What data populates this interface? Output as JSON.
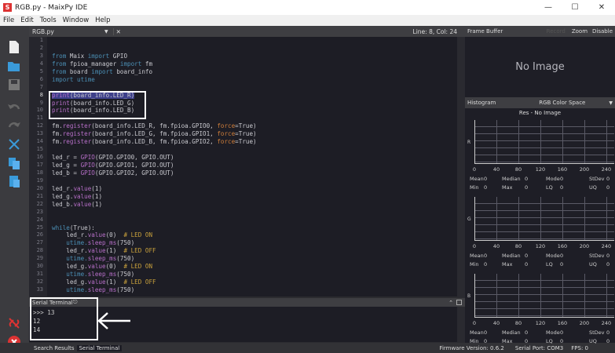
{
  "window": {
    "title": "RGB.py - MaixPy IDE",
    "app_icon": "maixpy-logo"
  },
  "menu": [
    "File",
    "Edit",
    "Tools",
    "Window",
    "Help"
  ],
  "editor": {
    "tab": "RGB.py",
    "cursor": "Line: 8, Col: 24",
    "lines": [
      [],
      [],
      [
        [
          "from ",
          "kw"
        ],
        [
          "Maix ",
          "tx"
        ],
        [
          "import ",
          "kw"
        ],
        [
          "GPIO",
          "tx"
        ]
      ],
      [
        [
          "from ",
          "kw"
        ],
        [
          "fpioa_manager ",
          "tx"
        ],
        [
          "import ",
          "kw"
        ],
        [
          "fm",
          "tx"
        ]
      ],
      [
        [
          "from ",
          "kw"
        ],
        [
          "board ",
          "tx"
        ],
        [
          "import ",
          "kw"
        ],
        [
          "board_info",
          "tx"
        ]
      ],
      [
        [
          "import ",
          "kw"
        ],
        [
          "utime",
          "kw"
        ]
      ],
      [],
      [
        [
          "print",
          "fn sel"
        ],
        [
          "(board_info.LED_R)",
          "tx sel"
        ]
      ],
      [
        [
          "print",
          "fn"
        ],
        [
          "(board_info.LED_G)",
          "tx"
        ]
      ],
      [
        [
          "print",
          "fn"
        ],
        [
          "(board_info.LED_B)",
          "tx"
        ]
      ],
      [],
      [
        [
          "fm.",
          "tx"
        ],
        [
          "register",
          "fn"
        ],
        [
          "(board_info.LED_R, fm.fpioa.GPIO0, ",
          "tx"
        ],
        [
          "force",
          "kwa"
        ],
        [
          "=True)",
          "tx"
        ]
      ],
      [
        [
          "fm.",
          "tx"
        ],
        [
          "register",
          "fn"
        ],
        [
          "(board_info.LED_G, fm.fpioa.GPIO1, ",
          "tx"
        ],
        [
          "force",
          "kwa"
        ],
        [
          "=True)",
          "tx"
        ]
      ],
      [
        [
          "fm.",
          "tx"
        ],
        [
          "register",
          "fn"
        ],
        [
          "(board_info.LED_B, fm.fpioa.GPIO2, ",
          "tx"
        ],
        [
          "force",
          "kwa"
        ],
        [
          "=True)",
          "tx"
        ]
      ],
      [],
      [
        [
          "led_r = ",
          "tx"
        ],
        [
          "GPIO",
          "fn"
        ],
        [
          "(GPIO.GPIO0, GPIO.OUT)",
          "tx"
        ]
      ],
      [
        [
          "led_g = ",
          "tx"
        ],
        [
          "GPIO",
          "fn"
        ],
        [
          "(GPIO.GPIO1, GPIO.OUT)",
          "tx"
        ]
      ],
      [
        [
          "led_b = ",
          "tx"
        ],
        [
          "GPIO",
          "fn"
        ],
        [
          "(GPIO.GPIO2, GPIO.OUT)",
          "tx"
        ]
      ],
      [],
      [
        [
          "led_r.",
          "tx"
        ],
        [
          "value",
          "fn"
        ],
        [
          "(1)",
          "tx"
        ]
      ],
      [
        [
          "led_g.",
          "tx"
        ],
        [
          "value",
          "fn"
        ],
        [
          "(1)",
          "tx"
        ]
      ],
      [
        [
          "led_b.",
          "tx"
        ],
        [
          "value",
          "fn"
        ],
        [
          "(1)",
          "tx"
        ]
      ],
      [],
      [],
      [
        [
          "while",
          "kw"
        ],
        [
          "(True):",
          "tx"
        ]
      ],
      [
        [
          "    led_r.",
          "tx"
        ],
        [
          "value",
          "fn"
        ],
        [
          "(0)  ",
          "tx"
        ],
        [
          "# LED ON",
          "cm"
        ]
      ],
      [
        [
          "    utime.",
          "kw"
        ],
        [
          "sleep_ms",
          "fn"
        ],
        [
          "(750)",
          "tx"
        ]
      ],
      [
        [
          "    led_r.",
          "tx"
        ],
        [
          "value",
          "fn"
        ],
        [
          "(1)  ",
          "tx"
        ],
        [
          "# LED OFF",
          "cm"
        ]
      ],
      [
        [
          "    utime.",
          "kw"
        ],
        [
          "sleep_ms",
          "fn"
        ],
        [
          "(750)",
          "tx"
        ]
      ],
      [
        [
          "    led_g.",
          "tx"
        ],
        [
          "value",
          "fn"
        ],
        [
          "(0)  ",
          "tx"
        ],
        [
          "# LED ON",
          "cm"
        ]
      ],
      [
        [
          "    utime.",
          "kw"
        ],
        [
          "sleep_ms",
          "fn"
        ],
        [
          "(750)",
          "tx"
        ]
      ],
      [
        [
          "    led_g.",
          "tx"
        ],
        [
          "value",
          "fn"
        ],
        [
          "(1)  ",
          "tx"
        ],
        [
          "# LED OFF",
          "cm"
        ]
      ],
      [
        [
          "    utime.",
          "kw"
        ],
        [
          "sleep_ms",
          "fn"
        ],
        [
          "(750)",
          "tx"
        ]
      ]
    ]
  },
  "terminal": {
    "title": "Serial Terminal",
    "lines": [
      ">>> 13",
      "12",
      "14"
    ]
  },
  "bottom": {
    "tabs": [
      "Search Results",
      "Serial Terminal"
    ],
    "firmware": "Firmware Version: 0.6.2",
    "port": "Serial Port: COM3",
    "fps": "FPS: 0"
  },
  "frame_buffer": {
    "title": "Frame Buffer",
    "record": "Record",
    "zoom": "Zoom",
    "disable": "Disable",
    "no_image": "No Image"
  },
  "histogram": {
    "title": "Histogram",
    "color_space": "RGB Color Space",
    "res": "Res - No Image",
    "ticks": [
      "0",
      "40",
      "80",
      "120",
      "160",
      "200",
      "240"
    ],
    "channels": [
      {
        "label": "R",
        "stats": [
          [
            "Mean",
            "0"
          ],
          [
            "Median",
            "0"
          ],
          [
            "Mode",
            "0"
          ],
          [
            "StDev",
            "0"
          ],
          [
            "Min",
            "0"
          ],
          [
            "Max",
            "0"
          ],
          [
            "LQ",
            "0"
          ],
          [
            "UQ",
            "0"
          ]
        ]
      },
      {
        "label": "G",
        "stats": [
          [
            "Mean",
            "0"
          ],
          [
            "Median",
            "0"
          ],
          [
            "Mode",
            "0"
          ],
          [
            "StDev",
            "0"
          ],
          [
            "Min",
            "0"
          ],
          [
            "Max",
            "0"
          ],
          [
            "LQ",
            "0"
          ],
          [
            "UQ",
            "0"
          ]
        ]
      },
      {
        "label": "B",
        "stats": [
          [
            "Mean",
            "0"
          ],
          [
            "Median",
            "0"
          ],
          [
            "Mode",
            "0"
          ],
          [
            "StDev",
            "0"
          ],
          [
            "Min",
            "0"
          ],
          [
            "Max",
            "0"
          ],
          [
            "LQ",
            "0"
          ],
          [
            "UQ",
            "0"
          ]
        ]
      }
    ]
  }
}
